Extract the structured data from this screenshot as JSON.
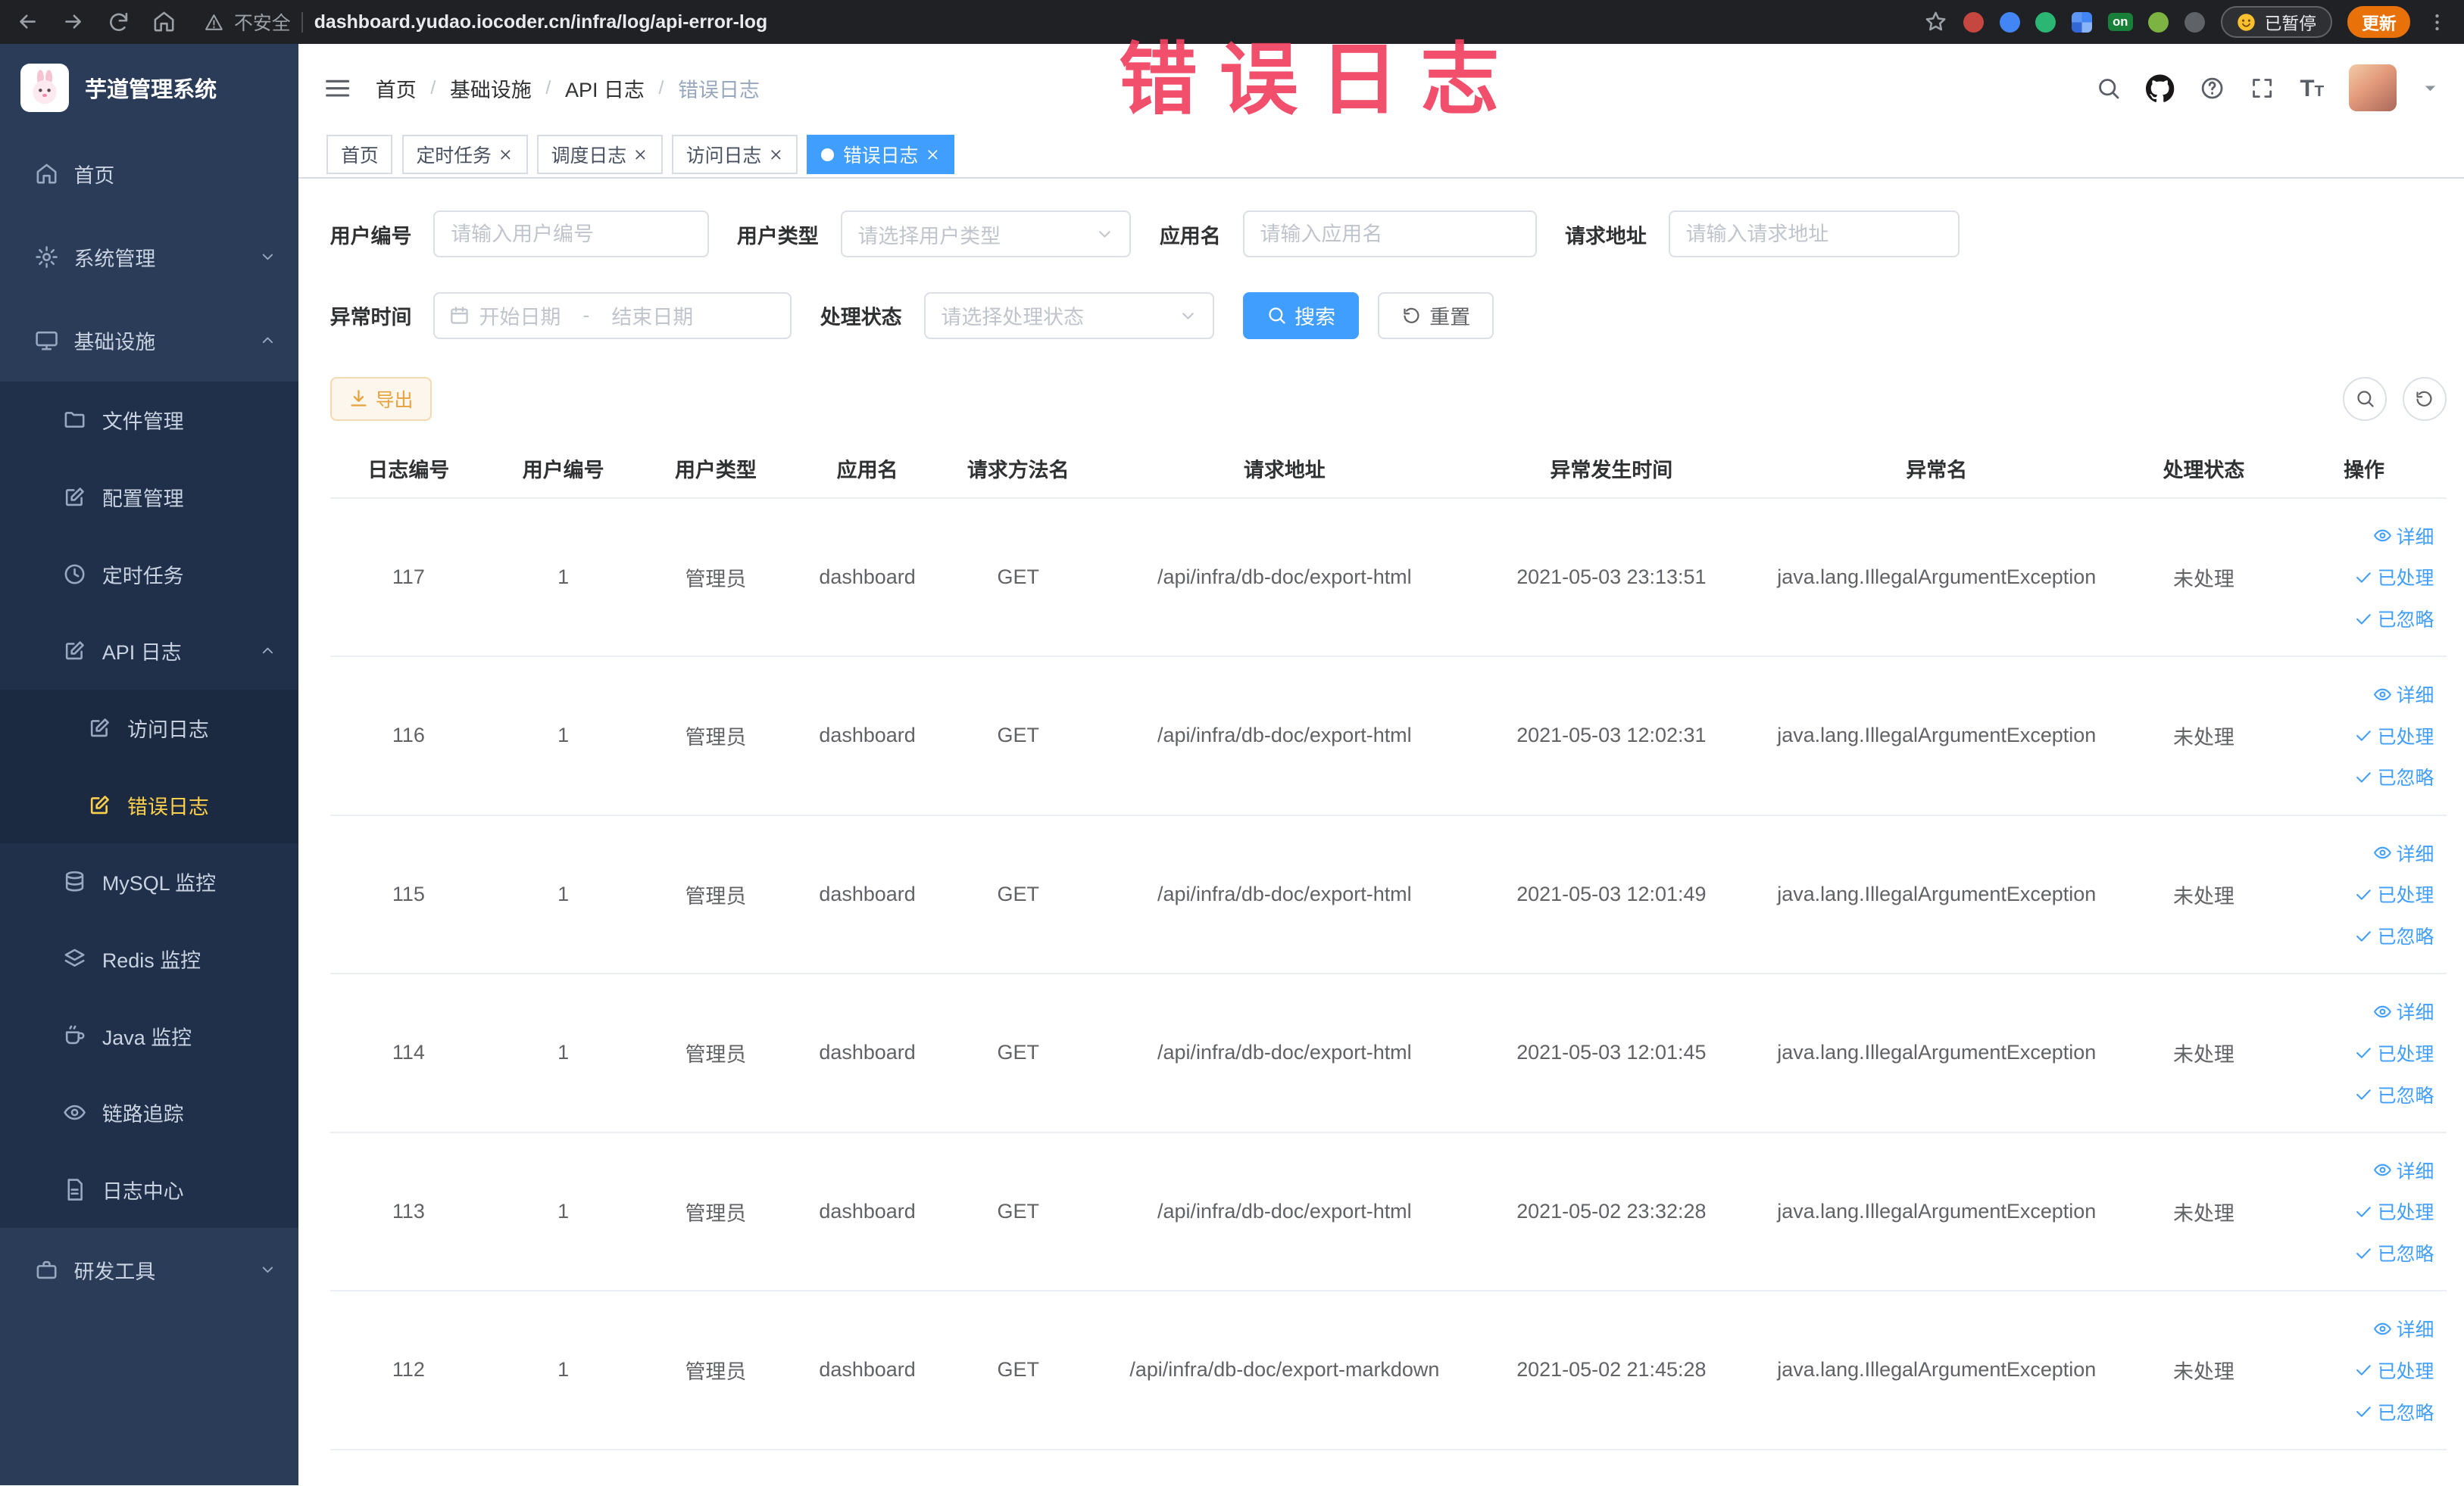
{
  "annotation": {
    "text": "错误日志"
  },
  "browser": {
    "security_label": "不安全",
    "url": "dashboard.yudao.iocoder.cn/infra/log/api-error-log",
    "on_badge": "on",
    "paused_label": "已暂停",
    "update_label": "更新"
  },
  "sidebar": {
    "logo_title": "芋道管理系统",
    "items": [
      "首页",
      "系统管理",
      "基础设施",
      "文件管理",
      "配置管理",
      "定时任务",
      "API 日志",
      "访问日志",
      "错误日志",
      "MySQL 监控",
      "Redis 监控",
      "Java 监控",
      "链路追踪",
      "日志中心",
      "研发工具"
    ]
  },
  "header": {
    "breadcrumb": [
      "首页",
      "基础设施",
      "API 日志",
      "错误日志"
    ]
  },
  "tabs": [
    "首页",
    "定时任务",
    "调度日志",
    "访问日志",
    "错误日志"
  ],
  "filters": {
    "user_id": {
      "label": "用户编号",
      "placeholder": "请输入用户编号"
    },
    "user_type": {
      "label": "用户类型",
      "placeholder": "请选择用户类型"
    },
    "app_name": {
      "label": "应用名",
      "placeholder": "请输入应用名"
    },
    "request_url": {
      "label": "请求地址",
      "placeholder": "请输入请求地址"
    },
    "exception_time": {
      "label": "异常时间",
      "start_placeholder": "开始日期",
      "separator": "-",
      "end_placeholder": "结束日期"
    },
    "process_status": {
      "label": "处理状态",
      "placeholder": "请选择处理状态"
    },
    "search_label": "搜索",
    "reset_label": "重置"
  },
  "toolbar": {
    "export_label": "导出"
  },
  "table": {
    "columns": [
      "日志编号",
      "用户编号",
      "用户类型",
      "应用名",
      "请求方法名",
      "请求地址",
      "异常发生时间",
      "异常名",
      "处理状态",
      "操作"
    ],
    "action_labels": {
      "detail": "详细",
      "processed": "已处理",
      "ignored": "已忽略"
    },
    "rows": [
      {
        "id": "117",
        "user_id": "1",
        "user_type": "管理员",
        "app_name": "dashboard",
        "method": "GET",
        "url": "/api/infra/db-doc/export-html",
        "time": "2021-05-03 23:13:51",
        "exception": "java.lang.IllegalArgumentException",
        "status": "未处理"
      },
      {
        "id": "116",
        "user_id": "1",
        "user_type": "管理员",
        "app_name": "dashboard",
        "method": "GET",
        "url": "/api/infra/db-doc/export-html",
        "time": "2021-05-03 12:02:31",
        "exception": "java.lang.IllegalArgumentException",
        "status": "未处理"
      },
      {
        "id": "115",
        "user_id": "1",
        "user_type": "管理员",
        "app_name": "dashboard",
        "method": "GET",
        "url": "/api/infra/db-doc/export-html",
        "time": "2021-05-03 12:01:49",
        "exception": "java.lang.IllegalArgumentException",
        "status": "未处理"
      },
      {
        "id": "114",
        "user_id": "1",
        "user_type": "管理员",
        "app_name": "dashboard",
        "method": "GET",
        "url": "/api/infra/db-doc/export-html",
        "time": "2021-05-03 12:01:45",
        "exception": "java.lang.IllegalArgumentException",
        "status": "未处理"
      },
      {
        "id": "113",
        "user_id": "1",
        "user_type": "管理员",
        "app_name": "dashboard",
        "method": "GET",
        "url": "/api/infra/db-doc/export-html",
        "time": "2021-05-02 23:32:28",
        "exception": "java.lang.IllegalArgumentException",
        "status": "未处理"
      },
      {
        "id": "112",
        "user_id": "1",
        "user_type": "管理员",
        "app_name": "dashboard",
        "method": "GET",
        "url": "/api/infra/db-doc/export-markdown",
        "time": "2021-05-02 21:45:28",
        "exception": "java.lang.IllegalArgumentException",
        "status": "未处理"
      }
    ]
  },
  "colors": {
    "accent": "#409eff",
    "sidebar_bg": "#2b3c58",
    "submenu_bg": "#20304a",
    "active_menu_text": "#ffd04b",
    "warning_button_text": "#e6a23c",
    "annotation_red": "#f0415f",
    "chrome_bg": "#202124",
    "update_badge": "#e8710a"
  }
}
